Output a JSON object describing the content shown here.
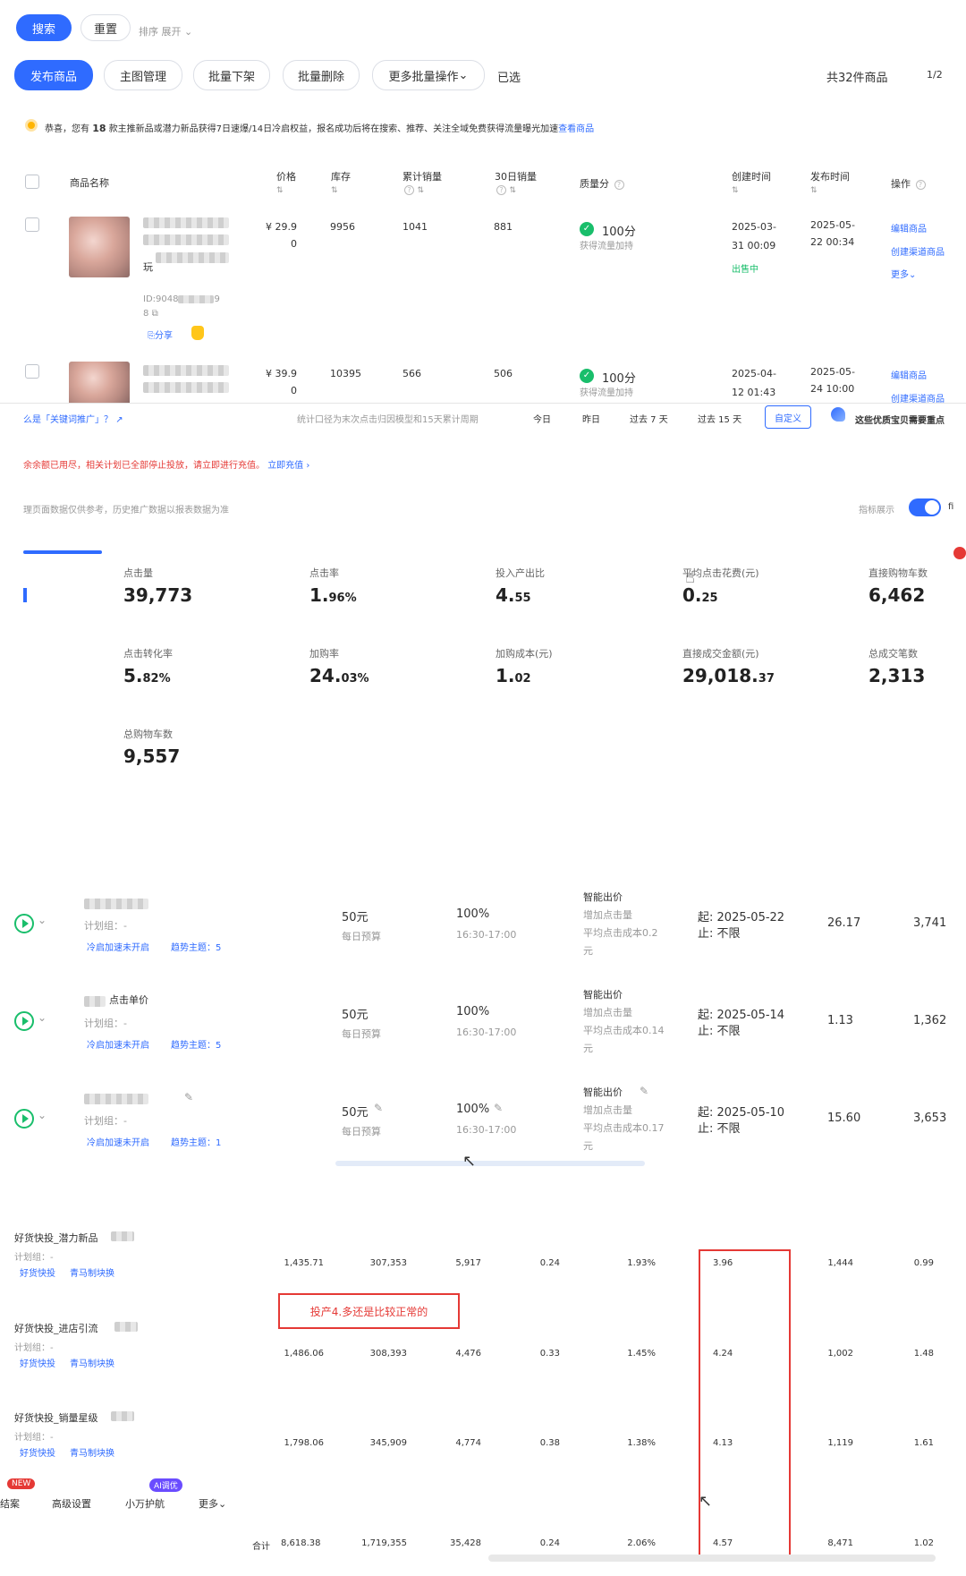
{
  "top_bar": {
    "search": "搜索",
    "reset": "重置",
    "sort": "排序",
    "expand": "展开"
  },
  "toolbar": {
    "publish": "发布商品",
    "main_image": "主图管理",
    "batch_off": "批量下架",
    "batch_delete": "批量删除",
    "more_batch": "更多批量操作",
    "selected": "已选",
    "total": "共32件商品",
    "page": "1/2"
  },
  "notice": {
    "prefix": "恭喜，您有",
    "count": "18",
    "text": "款主推新品或潜力新品获得7日速爆/14日冷启权益，报名成功后将在搜索、推荐、关注全域免费获得流量曝光加速",
    "link": "查看商品"
  },
  "table": {
    "headers": {
      "name": "商品名称",
      "price": "价格",
      "stock": "库存",
      "sales_total": "累计销量",
      "sales_30": "30日销量",
      "quality": "质量分",
      "created": "创建时间",
      "published": "发布时间",
      "ops": "操作"
    },
    "rows": [
      {
        "price": "¥ 29.9",
        "price2": "0",
        "stock": "9956",
        "sales_total": "1041",
        "sales_30": "881",
        "score": "100分",
        "score_note": "获得流量加持",
        "created1": "2025-03-",
        "created2": "31 00:09",
        "status": "出售中",
        "pub1": "2025-05-",
        "pub2": "22 00:34",
        "op1": "编辑商品",
        "op2": "创建渠道商品",
        "op3": "更多",
        "name_tail": "玩",
        "id": "ID:9048",
        "id_tail": "9",
        "id2": "8",
        "share": "分享"
      },
      {
        "price": "¥ 39.9",
        "price2": "0",
        "stock": "10395",
        "sales_total": "566",
        "sales_30": "506",
        "score": "100分",
        "score_note": "获得流量加持",
        "created1": "2025-04-",
        "created2": "12 01:43",
        "pub1": "2025-05-",
        "pub2": "24 10:00",
        "op1": "编辑商品",
        "op2": "创建渠道商品"
      }
    ]
  },
  "promo": {
    "bar": {
      "keyword": "么是「关键词推广」？",
      "stat_note": "统计口径为末次点击归因模型和15天累计周期",
      "today": "今日",
      "yesterday": "昨日",
      "last7": "过去 7 天",
      "last15": "过去 15 天",
      "custom": "自定义",
      "banner": "这些优质宝贝需要重点"
    },
    "warning": "余余额已用尽，相关计划已全部停止投放，请立即进行充值。",
    "recharge": "立即充值",
    "data_note": "理页面数据仅供参考，历史推广数据以报表数据为准",
    "toggle_label": "指标展示",
    "toggle_tail": "fi",
    "metrics": [
      {
        "label": "点击量",
        "value": "39,773"
      },
      {
        "label": "点击率",
        "value": "1.",
        "small": "96%"
      },
      {
        "label": "投入产出比",
        "value": "4.",
        "small": "55"
      },
      {
        "label": "平均点击花费(元)",
        "value": "0.",
        "small": "25"
      },
      {
        "label": "直接购物车数",
        "value": "6,462"
      },
      {
        "label": "点击转化率",
        "value": "5.",
        "small": "82%"
      },
      {
        "label": "加购率",
        "value": "24.",
        "small": "03%"
      },
      {
        "label": "加购成本(元)",
        "value": "1.",
        "small": "02"
      },
      {
        "label": "直接成交金额(元)",
        "value": "29,018.",
        "small": "37"
      },
      {
        "label": "总成交笔数",
        "value": "2,313"
      },
      {
        "label": "总购物车数",
        "value": "9,557"
      }
    ]
  },
  "plans": [
    {
      "title": "",
      "group": "计划组：-",
      "tag1": "冷启加速未开启",
      "tag2": "趋势主题：5",
      "budget": "50元",
      "budget_label": "每日预算",
      "rate": "100%",
      "time": "16:30-17:00",
      "bid_title": "智能出价",
      "bid1": "增加点击量",
      "bid2": "平均点击成本0.2",
      "bid3": "元",
      "start": "2025-05-22",
      "end": "不限",
      "v1": "26.17",
      "v2": "3,741"
    },
    {
      "title": "点击单价",
      "group": "计划组：-",
      "tag1": "冷启加速未开启",
      "tag2": "趋势主题：5",
      "budget": "50元",
      "budget_label": "每日预算",
      "rate": "100%",
      "time": "16:30-17:00",
      "bid_title": "智能出价",
      "bid1": "增加点击量",
      "bid2": "平均点击成本0.14",
      "bid3": "元",
      "start": "2025-05-14",
      "end": "不限",
      "v1": "1.13",
      "v2": "1,362"
    },
    {
      "title": "",
      "group": "计划组：-",
      "tag1": "冷启加速未开启",
      "tag2": "趋势主题：1",
      "budget": "50元",
      "budget_label": "每日预算",
      "rate": "100%",
      "time": "16:30-17:00",
      "bid_title": "智能出价",
      "bid1": "增加点击量",
      "bid2": "平均点击成本0.17",
      "bid3": "元",
      "start": "2025-05-10",
      "end": "不限",
      "v1": "15.60",
      "v2": "3,653"
    }
  ],
  "plan_labels": {
    "start": "起:",
    "end": "止:"
  },
  "report": {
    "rows": [
      {
        "name": "好货快投_潜力新品",
        "group": "计划组：-",
        "t1": "好货快投",
        "t2": "青马制块换",
        "c": [
          "1,435.71",
          "307,353",
          "5,917",
          "0.24",
          "1.93%",
          "3.96",
          "1,444",
          "0.99"
        ]
      },
      {
        "name": "好货快投_进店引流",
        "group": "计划组：-",
        "t1": "好货快投",
        "t2": "青马制块换",
        "c": [
          "1,486.06",
          "308,393",
          "4,476",
          "0.33",
          "1.45%",
          "4.24",
          "1,002",
          "1.48"
        ]
      },
      {
        "name": "好货快投_销量星级",
        "group": "计划组：-",
        "t1": "好货快投",
        "t2": "青马制块换",
        "c": [
          "1,798.06",
          "345,909",
          "4,774",
          "0.38",
          "1.38%",
          "4.13",
          "1,119",
          "1.61"
        ]
      }
    ],
    "total_label": "合计",
    "total": [
      "8,618.38",
      "1,719,355",
      "35,428",
      "0.24",
      "2.06%",
      "4.57",
      "8,471",
      "1.02"
    ],
    "annotation": "投产4.多还是比较正常的",
    "bottom": {
      "new": "NEW",
      "result": "结案",
      "advanced": "高级设置",
      "ai": "AI调优",
      "nav": "小万护航",
      "more": "更多"
    }
  },
  "colors": {
    "primary": "#2f6bff",
    "green": "#19be6b",
    "red": "#e53935"
  }
}
